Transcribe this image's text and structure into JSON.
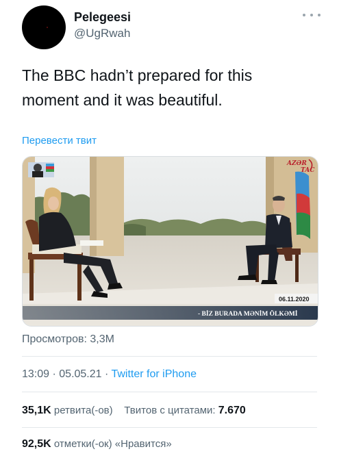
{
  "author": {
    "display_name": "Pelegeesi",
    "handle": "@UgRwah"
  },
  "tweet": {
    "text": "The BBC hadn’t prepared for this moment and it was beautiful.",
    "translate_label": "Перевести твит"
  },
  "media": {
    "broadcaster_logo": "AZƏR TAC",
    "date_caption": "06.11.2020",
    "ticker": "- BİZ BURADA MƏNİM ÖLKƏMİ"
  },
  "views": "Просмотров: 3,3M",
  "meta": {
    "time": "13:09",
    "separator1": " · ",
    "date": "05.05.21",
    "separator2": " · ",
    "source": "Twitter for iPhone"
  },
  "stats": {
    "retweets_count": "35,1K",
    "retweets_label": "ретвита(-ов)",
    "quotes_label": "Твитов с цитатами:",
    "quotes_count": "7.670",
    "likes_count": "92,5K",
    "likes_label": "отметки(-ок) «Нравится»"
  },
  "colors": {
    "link": "#1d9bf0",
    "secondary_text": "#536471",
    "primary_text": "#0f1419"
  },
  "icons": {
    "more": "more-horizontal-icon"
  }
}
